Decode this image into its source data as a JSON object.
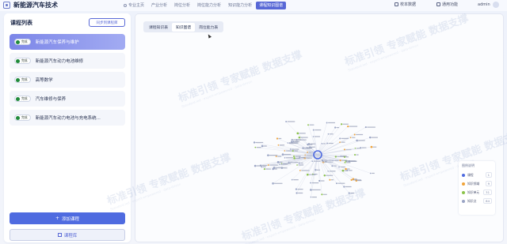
{
  "app": {
    "title": "新能源汽车技术"
  },
  "nav": {
    "items": [
      {
        "label": "专业主页",
        "active": false
      },
      {
        "label": "产业分析",
        "active": false
      },
      {
        "label": "岗位分析",
        "active": false
      },
      {
        "label": "岗位能力分析",
        "active": false
      },
      {
        "label": "知识能力分析",
        "active": false
      },
      {
        "label": "课程知识图谱",
        "active": true
      }
    ]
  },
  "top_right": {
    "school_data": "校本数据",
    "common_functions": "通用功能",
    "user": "admin"
  },
  "sidebar": {
    "title": "课程列表",
    "sync_label": "同步到课程库",
    "courses": [
      {
        "status": "完成",
        "name": "新能源汽车保养与维护",
        "active": true
      },
      {
        "status": "完成",
        "name": "新能源汽车动力电池维修",
        "active": false
      },
      {
        "status": "完成",
        "name": "高等数学",
        "active": false
      },
      {
        "status": "完成",
        "name": "汽车维修与保养",
        "active": false
      },
      {
        "status": "完成",
        "name": "新能源汽车动力电池与充电系统...",
        "active": false
      }
    ],
    "add_label": "添加课程",
    "library_label": "课程库"
  },
  "main": {
    "tabs": [
      {
        "label": "课程知识表",
        "active": false
      },
      {
        "label": "知识图谱",
        "active": true
      },
      {
        "label": "岗位能力表",
        "active": false
      }
    ],
    "watermark": "标准引领 专家赋能 数据支撑",
    "watermark_sub": "Standard-led · expert-empowered · data-driven"
  },
  "legend": {
    "title": "图例说明",
    "items": [
      {
        "label": "课程",
        "value": "1",
        "color": "#4f6be0"
      },
      {
        "label": "知识领域",
        "value": "9",
        "color": "#f0a43a"
      },
      {
        "label": "知识单元",
        "value": "31",
        "color": "#8bc34a"
      },
      {
        "label": "知识点",
        "value": "84",
        "color": "#9aa4c4"
      }
    ]
  },
  "colors": {
    "accent": "#5868d6",
    "primary_button": "#4f6be0",
    "status_green": "#1f8a3a"
  }
}
